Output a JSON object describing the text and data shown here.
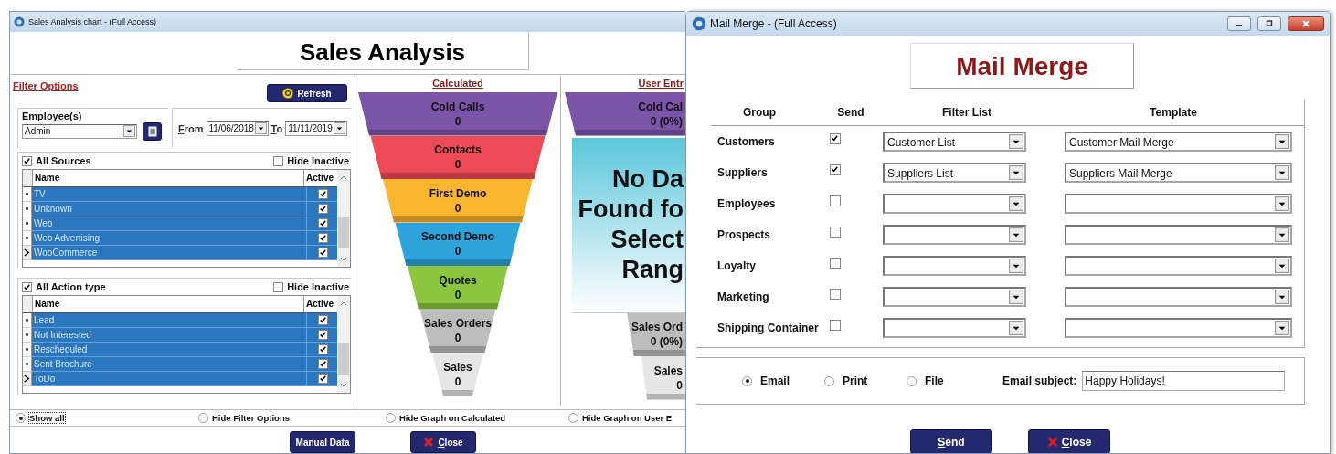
{
  "sales_window": {
    "title": "Sales Analysis chart - (Full Access)",
    "heading": "Sales Analysis",
    "filter": {
      "title": "Filter Options",
      "refresh_button": "Refresh",
      "employee": {
        "label": "Employee(s)",
        "value": "Admin"
      },
      "from": {
        "label": "From",
        "value": "11/06/2018"
      },
      "to": {
        "label": "To",
        "value": "11/11/2019"
      },
      "grids": [
        {
          "all_label": "All Sources",
          "all_checked": true,
          "hide_label": "Hide Inactive",
          "hide_checked": false,
          "columns": [
            "Name",
            "Active"
          ],
          "rows": [
            {
              "name": "TV",
              "active": true,
              "selected": true,
              "current": false
            },
            {
              "name": "Unknown",
              "active": true,
              "selected": true,
              "current": false
            },
            {
              "name": "Web",
              "active": true,
              "selected": true,
              "current": false
            },
            {
              "name": "Web Advertising",
              "active": true,
              "selected": true,
              "current": false
            },
            {
              "name": "WooCommerce",
              "active": true,
              "selected": true,
              "current": true
            }
          ]
        },
        {
          "all_label": "All Action type",
          "all_checked": true,
          "hide_label": "Hide Inactive",
          "hide_checked": false,
          "columns": [
            "Name",
            "Active"
          ],
          "rows": [
            {
              "name": "Lead",
              "active": true,
              "selected": true,
              "current": false
            },
            {
              "name": "Not Interested",
              "active": true,
              "selected": true,
              "current": false
            },
            {
              "name": "Rescheduled",
              "active": true,
              "selected": true,
              "current": false
            },
            {
              "name": "Sent Brochure",
              "active": true,
              "selected": true,
              "current": false
            },
            {
              "name": "ToDo",
              "active": true,
              "selected": true,
              "current": true
            }
          ]
        }
      ]
    },
    "calculated": {
      "heading": "Calculated",
      "stages": [
        {
          "label": "Cold Calls",
          "value": "0",
          "color": "#7d55a8"
        },
        {
          "label": "Contacts",
          "value": "0",
          "color": "#ec4a56"
        },
        {
          "label": "First Demo",
          "value": "0",
          "color": "#f9b430"
        },
        {
          "label": "Second Demo",
          "value": "0",
          "color": "#2ea3dc"
        },
        {
          "label": "Quotes",
          "value": "0",
          "color": "#8cc63f"
        },
        {
          "label": "Sales Orders",
          "value": "0",
          "color": "#bdbdbd"
        },
        {
          "label": "Sales",
          "value": "0",
          "color": "#e6e6e6"
        }
      ]
    },
    "user_entry": {
      "heading": "User Entr",
      "stages": [
        {
          "kind": "stage",
          "label": "Cold Cal",
          "value": "0 (0%)",
          "color": "#7d55a8"
        },
        {
          "kind": "message",
          "lines": [
            "No Da",
            "Found fo",
            "Select",
            "Rang"
          ]
        },
        {
          "kind": "stage",
          "label": "Sales Ord",
          "value": "0 (0%)",
          "color": "#bdbdbd"
        },
        {
          "kind": "stage",
          "label": "Sales",
          "value": "0",
          "color": "#e6e6e6"
        }
      ]
    },
    "view_options": [
      {
        "label": "Show all",
        "selected": true
      },
      {
        "label": "Hide Filter Options",
        "selected": false
      },
      {
        "label": "Hide Graph on Calculated",
        "selected": false
      },
      {
        "label": "Hide Graph on User E",
        "selected": false
      }
    ],
    "buttons": [
      {
        "label": "Manual Data",
        "kind": "plain"
      },
      {
        "label": "Close",
        "kind": "close"
      }
    ]
  },
  "mail_window": {
    "title": "Mail Merge - (Full Access)",
    "heading": "Mail Merge",
    "columns": [
      "Group",
      "Send",
      "Filter List",
      "Template"
    ],
    "rows": [
      {
        "group": "Customers",
        "send": true,
        "filter_list": "Customer List",
        "template": "Customer Mail Merge"
      },
      {
        "group": "Suppliers",
        "send": true,
        "filter_list": "Suppliers List",
        "template": "Suppliers Mail Merge"
      },
      {
        "group": "Employees",
        "send": false
      },
      {
        "group": "Prospects",
        "send": false
      },
      {
        "group": "Loyalty",
        "send": false
      },
      {
        "group": "Marketing",
        "send": false
      },
      {
        "group": "Shipping Container",
        "send": false
      }
    ],
    "outputs": [
      {
        "label": "Email",
        "selected": true
      },
      {
        "label": "Print",
        "selected": false
      },
      {
        "label": "File",
        "selected": false
      }
    ],
    "subject": {
      "label": "Email subject:",
      "value": "Happy Holidays!"
    },
    "buttons": [
      {
        "label": "Send",
        "kind": "plain"
      },
      {
        "label": "Close",
        "kind": "close"
      }
    ]
  }
}
